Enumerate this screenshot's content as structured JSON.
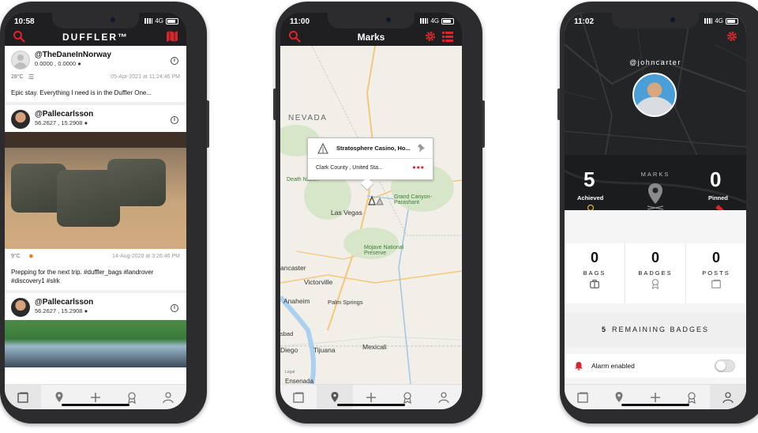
{
  "colors": {
    "accent": "#d9262d",
    "dark": "#1f1f21",
    "map_bg": "#f1efe7"
  },
  "phone1": {
    "status_time": "10:58",
    "status_net": "4G",
    "title": "DUFFLER™",
    "posts": [
      {
        "user": "@TheDaneInNorway",
        "coords": "0.0000 , 0.0000",
        "temp": "28°C",
        "date": "05-Apr-2021 at 11:24:46 PM",
        "caption": "Epic stay. Everything I need is in the Duffler One..."
      },
      {
        "user": "@Pallecarlsson",
        "coords": "56.2627 , 15.2908",
        "temp": "9°C",
        "date": "14-Aug-2020 at 3:26:46 PM",
        "caption": "Prepping for the next trip. #duffler_bags #landrover #discovery1 #slrk"
      },
      {
        "user": "@Pallecarlsson",
        "coords": "56.2627 , 15.2908"
      }
    ],
    "info_glyph": "i"
  },
  "phone2": {
    "status_time": "11:00",
    "status_net": "4G",
    "title": "Marks",
    "map_labels": {
      "state": "NEVADA",
      "las_vegas": "Las Vegas",
      "grand_canyon": "Grand Canyon-Parashant",
      "mojave": "Mojave National Preserve",
      "victorville": "Victorville",
      "anaheim": "Anaheim",
      "palm_springs": "Palm Springs",
      "lancaster": "ancaster",
      "tijuana": "Tijuana",
      "mexicali": "Mexicali",
      "diego": "Diego",
      "ensenada": "Ensenada",
      "legal": "Legal",
      "death_valley": "Death Nation",
      "sbad": "sbad"
    },
    "popup": {
      "title": "Stratosphere Casino, Ho...",
      "subtitle": "Clark County , United Sta...",
      "more": "•••"
    }
  },
  "phone3": {
    "status_time": "11:02",
    "status_net": "4G",
    "handle": "@johncarter",
    "marks_label": "MARKS",
    "achieved": {
      "value": "5",
      "label": "Achieved"
    },
    "pinned": {
      "value": "0",
      "label": "Pinned"
    },
    "stats": [
      {
        "value": "0",
        "label": "BAGS"
      },
      {
        "value": "0",
        "label": "BADGES"
      },
      {
        "value": "0",
        "label": "POSTS"
      }
    ],
    "remaining": {
      "count": "5",
      "label": "REMAINING BADGES"
    },
    "alarm_label": "Alarm enabled",
    "alarm_enabled": false
  }
}
